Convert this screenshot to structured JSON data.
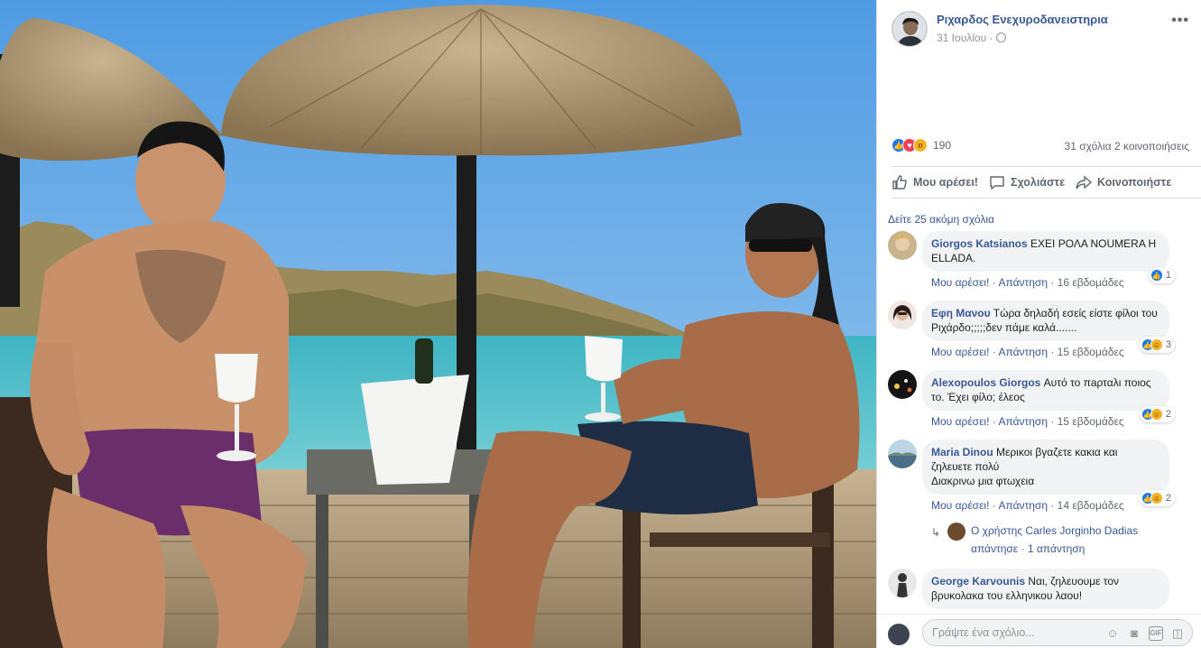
{
  "post": {
    "author": "Ριχαρδος Ενεχυροδανειστηρια",
    "date": "31 Ιουλίου ·",
    "more_label": "•••"
  },
  "stats": {
    "reaction_count": "190",
    "comments_shares": "31 σχόλια  2 κοινοποιήσεις"
  },
  "actions": {
    "like": "Μου αρέσει!",
    "comment": "Σχολιάστε",
    "share": "Κοινοποιήστε"
  },
  "view_more_comments": "Δείτε 25 ακόμη σχόλια",
  "comments": [
    {
      "name": "Giorgos Katsianos",
      "text": " ΕΧΕΙ ΡΟΛΑ ΝΟUMERA Η ELLADA.",
      "like": "Μου αρέσει!",
      "reply": "Απάντηση",
      "time": "16 εβδομάδες",
      "reactions": "1"
    },
    {
      "name": "Εφη Μανου",
      "text": " Τώρα δηλαδή εσείς είστε φίλοι του Ριχάρδο;;;;;δεν πάμε καλά.......",
      "like": "Μου αρέσει!",
      "reply": "Απάντηση",
      "time": "15 εβδομάδες",
      "reactions": "3"
    },
    {
      "name": "Alexopoulos Giorgos",
      "text": " Αυτό το πaρταλι ποιος το. Έχει φίλο; έλεος",
      "like": "Μου αρέσει!",
      "reply": "Απάντηση",
      "time": "15 εβδομάδες",
      "reactions": "2"
    },
    {
      "name": "Maria Dinou",
      "text": " Μερικοι βγαζετε κακια και ζηλευετε πολύ",
      "text2": "Διακρινω μια φτωχεια",
      "like": "Μου αρέσει!",
      "reply": "Απάντηση",
      "time": "14 εβδομάδες",
      "reactions": "2"
    },
    {
      "name": "George Karvounis",
      "text": " Ναι, ζηλευουμε τον βρυκολακα του ελληνικου λαου!"
    }
  ],
  "reply_thread": {
    "arrow": "↳",
    "text": "Ο χρήστης Carles Jorginho Dadias",
    "reply_link": "απάντησε",
    "separator": "·",
    "count": "1 απάντηση"
  },
  "composer": {
    "placeholder": "Γράψτε ένα σχόλιο..."
  },
  "icons": {
    "like": "thumbs-up-icon",
    "comment": "speech-bubble-icon",
    "share": "share-arrow-icon",
    "privacy": "globe-icon",
    "emoji": "emoji-icon",
    "camera": "camera-icon",
    "gif": "gif-icon",
    "sticker": "sticker-icon"
  },
  "colors": {
    "link": "#385898",
    "meta": "#606770",
    "like_blue": "#1877f2",
    "love_red": "#f33e58",
    "haha_yellow": "#f7b125"
  }
}
